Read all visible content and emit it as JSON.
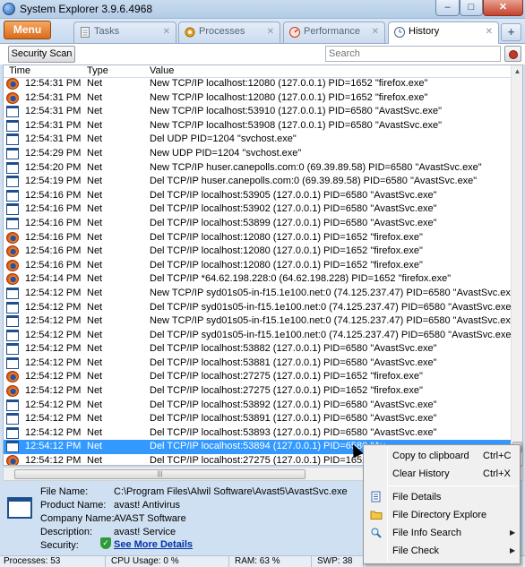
{
  "window": {
    "title": "System Explorer 3.9.6.4968",
    "buttons": {
      "minimize": "–",
      "maximize": "□",
      "close": "✕"
    }
  },
  "tabs": {
    "menu_label": "Menu",
    "items": [
      {
        "label": "Tasks",
        "icon": "document-icon"
      },
      {
        "label": "Processes",
        "icon": "gear-icon"
      },
      {
        "label": "Performance",
        "icon": "gauge-icon"
      },
      {
        "label": "History",
        "icon": "clock-icon",
        "active": true
      }
    ],
    "add": "+"
  },
  "toolbar": {
    "security_scan": "Security Scan",
    "search_placeholder": "Search"
  },
  "list": {
    "columns": [
      "Time",
      "Type",
      "Value"
    ],
    "rows": [
      {
        "icon": "firefox",
        "time": "12:54:31 PM",
        "type": "Net",
        "value": "New TCP/IP localhost:12080 (127.0.0.1) PID=1652 \"firefox.exe\""
      },
      {
        "icon": "firefox",
        "time": "12:54:31 PM",
        "type": "Net",
        "value": "New TCP/IP localhost:12080 (127.0.0.1) PID=1652 \"firefox.exe\""
      },
      {
        "icon": "net",
        "time": "12:54:31 PM",
        "type": "Net",
        "value": "New TCP/IP localhost:53910 (127.0.0.1) PID=6580 \"AvastSvc.exe\""
      },
      {
        "icon": "net",
        "time": "12:54:31 PM",
        "type": "Net",
        "value": "New TCP/IP localhost:53908 (127.0.0.1) PID=6580 \"AvastSvc.exe\""
      },
      {
        "icon": "net",
        "time": "12:54:31 PM",
        "type": "Net",
        "value": "Del UDP PID=1204 \"svchost.exe\""
      },
      {
        "icon": "net",
        "time": "12:54:29 PM",
        "type": "Net",
        "value": "New UDP PID=1204 \"svchost.exe\""
      },
      {
        "icon": "net",
        "time": "12:54:20 PM",
        "type": "Net",
        "value": "New TCP/IP huser.canepolls.com:0 (69.39.89.58) PID=6580 \"AvastSvc.exe\""
      },
      {
        "icon": "net",
        "time": "12:54:19 PM",
        "type": "Net",
        "value": "Del TCP/IP huser.canepolls.com:0 (69.39.89.58) PID=6580 \"AvastSvc.exe\""
      },
      {
        "icon": "net",
        "time": "12:54:16 PM",
        "type": "Net",
        "value": "Del TCP/IP localhost:53905 (127.0.0.1) PID=6580 \"AvastSvc.exe\""
      },
      {
        "icon": "net",
        "time": "12:54:16 PM",
        "type": "Net",
        "value": "Del TCP/IP localhost:53902 (127.0.0.1) PID=6580 \"AvastSvc.exe\""
      },
      {
        "icon": "net",
        "time": "12:54:16 PM",
        "type": "Net",
        "value": "Del TCP/IP localhost:53899 (127.0.0.1) PID=6580 \"AvastSvc.exe\""
      },
      {
        "icon": "firefox",
        "time": "12:54:16 PM",
        "type": "Net",
        "value": "Del TCP/IP localhost:12080 (127.0.0.1) PID=1652 \"firefox.exe\""
      },
      {
        "icon": "firefox",
        "time": "12:54:16 PM",
        "type": "Net",
        "value": "Del TCP/IP localhost:12080 (127.0.0.1) PID=1652 \"firefox.exe\""
      },
      {
        "icon": "firefox",
        "time": "12:54:16 PM",
        "type": "Net",
        "value": "Del TCP/IP localhost:12080 (127.0.0.1) PID=1652 \"firefox.exe\""
      },
      {
        "icon": "firefox",
        "time": "12:54:14 PM",
        "type": "Net",
        "value": "Del TCP/IP *64.62.198.228:0 (64.62.198.228) PID=1652 \"firefox.exe\""
      },
      {
        "icon": "net",
        "time": "12:54:12 PM",
        "type": "Net",
        "value": "New TCP/IP syd01s05-in-f15.1e100.net:0 (74.125.237.47) PID=6580 \"AvastSvc.exe\""
      },
      {
        "icon": "net",
        "time": "12:54:12 PM",
        "type": "Net",
        "value": "Del TCP/IP syd01s05-in-f15.1e100.net:0 (74.125.237.47) PID=6580 \"AvastSvc.exe\""
      },
      {
        "icon": "net",
        "time": "12:54:12 PM",
        "type": "Net",
        "value": "New TCP/IP syd01s05-in-f15.1e100.net:0 (74.125.237.47) PID=6580 \"AvastSvc.exe\""
      },
      {
        "icon": "net",
        "time": "12:54:12 PM",
        "type": "Net",
        "value": "Del TCP/IP syd01s05-in-f15.1e100.net:0 (74.125.237.47) PID=6580 \"AvastSvc.exe\""
      },
      {
        "icon": "net",
        "time": "12:54:12 PM",
        "type": "Net",
        "value": "Del TCP/IP localhost:53882 (127.0.0.1) PID=6580 \"AvastSvc.exe\""
      },
      {
        "icon": "net",
        "time": "12:54:12 PM",
        "type": "Net",
        "value": "Del TCP/IP localhost:53881 (127.0.0.1) PID=6580 \"AvastSvc.exe\""
      },
      {
        "icon": "firefox",
        "time": "12:54:12 PM",
        "type": "Net",
        "value": "Del TCP/IP localhost:27275 (127.0.0.1) PID=1652 \"firefox.exe\""
      },
      {
        "icon": "firefox",
        "time": "12:54:12 PM",
        "type": "Net",
        "value": "Del TCP/IP localhost:27275 (127.0.0.1) PID=1652 \"firefox.exe\""
      },
      {
        "icon": "net",
        "time": "12:54:12 PM",
        "type": "Net",
        "value": "Del TCP/IP localhost:53892 (127.0.0.1) PID=6580 \"AvastSvc.exe\""
      },
      {
        "icon": "net",
        "time": "12:54:12 PM",
        "type": "Net",
        "value": "Del TCP/IP localhost:53891 (127.0.0.1) PID=6580 \"AvastSvc.exe\""
      },
      {
        "icon": "net",
        "time": "12:54:12 PM",
        "type": "Net",
        "value": "Del TCP/IP localhost:53893 (127.0.0.1) PID=6580 \"AvastSvc.exe\""
      },
      {
        "icon": "net",
        "time": "12:54:12 PM",
        "type": "Net",
        "value": "Del TCP/IP localhost:53894 (127.0.0.1) PID=6580 \"Av",
        "selected": true
      },
      {
        "icon": "firefox",
        "time": "12:54:12 PM",
        "type": "Net",
        "value": "Del TCP/IP localhost:27275 (127.0.0.1) PID=1652 \"f"
      }
    ]
  },
  "details": {
    "file_name_label": "File Name:",
    "file_name": "C:\\Program Files\\Alwil Software\\Avast5\\AvastSvc.exe",
    "product_name_label": "Product Name:",
    "product_name": "avast! Antivirus",
    "company_name_label": "Company Name:",
    "company_name": "AVAST Software",
    "description_label": "Description:",
    "description": "avast! Service",
    "security_label": "Security:",
    "security_link": "See More Details"
  },
  "context_menu": {
    "items": [
      {
        "label": "Copy to clipboard",
        "shortcut": "Ctrl+C",
        "icon": ""
      },
      {
        "label": "Clear History",
        "shortcut": "Ctrl+X",
        "icon": ""
      },
      {
        "label": "File Details",
        "shortcut": "",
        "icon": "file-details-icon"
      },
      {
        "label": "File Directory Explore",
        "shortcut": "",
        "icon": "folder-icon"
      },
      {
        "label": "File Info Search",
        "shortcut": "",
        "icon": "magnifier-icon",
        "submenu": true
      },
      {
        "label": "File Check",
        "shortcut": "",
        "icon": "",
        "submenu": true
      }
    ]
  },
  "statusbar": {
    "processes": "Processes: 53",
    "cpu": "CPU Usage: 0 %",
    "ram": "RAM: 63 %",
    "swp": "SWP: 38 %"
  },
  "colors": {
    "selection": "#3399ff",
    "menu_button": "#e07a2a",
    "window_frame": "#cfe0f2",
    "link": "#0033aa"
  }
}
